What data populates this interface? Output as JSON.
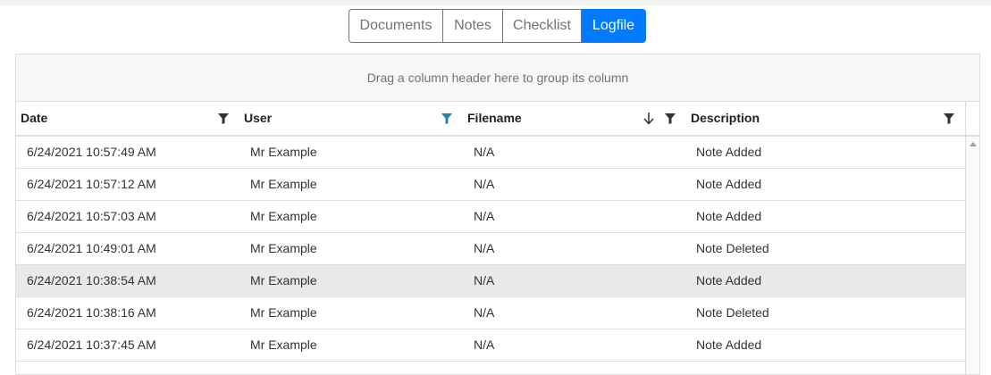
{
  "tabs": [
    {
      "label": "Documents",
      "active": false
    },
    {
      "label": "Notes",
      "active": false
    },
    {
      "label": "Checklist",
      "active": false
    },
    {
      "label": "Logfile",
      "active": true
    }
  ],
  "grid": {
    "group_panel_text": "Drag a column header here to group its column",
    "columns": [
      {
        "label": "Date",
        "filter_active": false,
        "sorted": false
      },
      {
        "label": "User",
        "filter_active": true,
        "sorted": false
      },
      {
        "label": "Filename",
        "filter_active": false,
        "sorted": "descending"
      },
      {
        "label": "Description",
        "filter_active": false,
        "sorted": false
      }
    ],
    "rows": [
      {
        "date": "6/24/2021 10:57:49 AM",
        "user": "Mr Example",
        "filename": "N/A",
        "description": "Note Added"
      },
      {
        "date": "6/24/2021 10:57:12 AM",
        "user": "Mr Example",
        "filename": "N/A",
        "description": "Note Added"
      },
      {
        "date": "6/24/2021 10:57:03 AM",
        "user": "Mr Example",
        "filename": "N/A",
        "description": "Note Added"
      },
      {
        "date": "6/24/2021 10:49:01 AM",
        "user": "Mr Example",
        "filename": "N/A",
        "description": "Note Deleted"
      },
      {
        "date": "6/24/2021 10:38:54 AM",
        "user": "Mr Example",
        "filename": "N/A",
        "description": "Note Added"
      },
      {
        "date": "6/24/2021 10:38:16 AM",
        "user": "Mr Example",
        "filename": "N/A",
        "description": "Note Deleted"
      },
      {
        "date": "6/24/2021 10:37:45 AM",
        "user": "Mr Example",
        "filename": "N/A",
        "description": "Note Added"
      }
    ]
  },
  "colors": {
    "accent": "#007bff",
    "filter_active": "#2a7fb0",
    "filter_inactive": "#333333",
    "hover_row": "#e9e9e9"
  },
  "icons": {
    "filter": "funnel-icon",
    "sort_desc": "arrow-down-icon",
    "scroll_up": "chevron-up-icon"
  }
}
